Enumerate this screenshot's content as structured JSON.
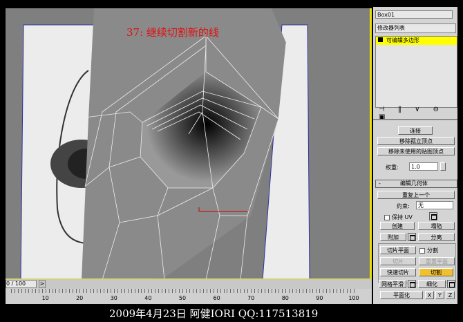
{
  "viewport": {
    "title": "37: 继续切割新的线"
  },
  "panel": {
    "object_name": "Box01",
    "modifier_list": "修改器列表",
    "stack_item": "可编辑多边形",
    "buttons": {
      "connect": "连接",
      "remove_isolated": "移除孤立顶点",
      "remove_unused_map": "移除未使用的贴图顶点"
    },
    "weight_label": "权重:",
    "weight_value": "1.0",
    "rollout_title": "编辑几何体",
    "repeat_last": "重复上一个",
    "constraint_label": "约束:",
    "constraint_value": "无",
    "preserve_uv": "保持 UV",
    "create": "创建",
    "collapse": "塌陷",
    "attach": "附加",
    "detach": "分离",
    "slice_plane": "切片平面",
    "split": "分割",
    "slice": "切片",
    "reset_plane": "重置平面",
    "quickslice": "快速切片",
    "cut": "切割",
    "meshsmooth": "网格平滑",
    "tessellate": "细化",
    "planarize": "平面化",
    "x": "X",
    "y": "Y",
    "z": "Z"
  },
  "timeline": {
    "frame": "0 / 100",
    "next": ">",
    "ticks": [
      "10",
      "20",
      "30",
      "40",
      "50",
      "60",
      "70",
      "80",
      "90",
      "100"
    ]
  },
  "caption": "2009年4月23日  阿健IORI  QQ:117513819",
  "colors": {
    "accent": "#f0c030",
    "stack_highlight": "#ffff00",
    "title": "#e01010"
  }
}
